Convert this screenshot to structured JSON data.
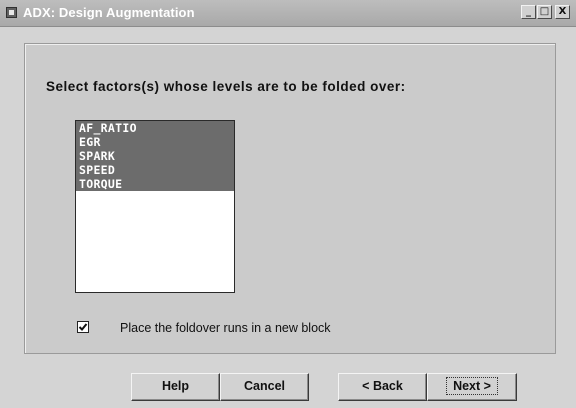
{
  "window": {
    "title": "ADX: Design Augmentation",
    "controls": {
      "minimize": "_",
      "maximize": "□",
      "close": "X"
    }
  },
  "dialog": {
    "instruction": "Select factors(s) whose levels are to be folded over:",
    "factors": [
      {
        "label": "AF_RATIO",
        "selected": true
      },
      {
        "label": "EGR",
        "selected": true
      },
      {
        "label": "SPARK",
        "selected": true
      },
      {
        "label": "SPEED",
        "selected": true
      },
      {
        "label": "TORQUE",
        "selected": true
      }
    ],
    "new_block_checkbox": {
      "label": "Place the foldover runs in a new block",
      "checked": true
    }
  },
  "buttons": {
    "help": "Help",
    "cancel": "Cancel",
    "back": "< Back",
    "next": "Next >"
  },
  "colors": {
    "titlebar": "#a9a9a9",
    "selection": "#6c6c6c",
    "dialog_bg": "#d4d4d4"
  }
}
